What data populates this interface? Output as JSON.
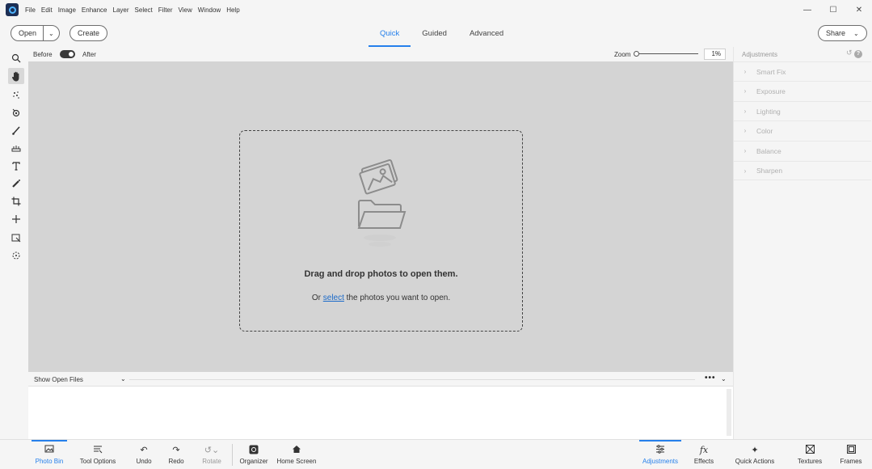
{
  "menubar": {
    "items": [
      "File",
      "Edit",
      "Image",
      "Enhance",
      "Layer",
      "Select",
      "Filter",
      "View",
      "Window",
      "Help"
    ]
  },
  "window_controls": {
    "minimize": "—",
    "maximize": "☐",
    "close": "✕"
  },
  "topbar": {
    "open_label": "Open",
    "create_label": "Create",
    "share_label": "Share",
    "modes": [
      "Quick",
      "Guided",
      "Advanced"
    ],
    "active_mode": "Quick"
  },
  "view_options": {
    "before_label": "Before",
    "after_label": "After",
    "zoom_label": "Zoom",
    "zoom_value": "1%"
  },
  "tools": [
    "zoom-tool",
    "hand-tool",
    "quick-selection-tool",
    "red-eye-tool",
    "whiten-teeth-tool",
    "straighten-tool",
    "type-tool",
    "spot-healing-tool",
    "crop-tool",
    "move-tool",
    "recompose-tool",
    "rotate-tool"
  ],
  "canvas": {
    "drop_title": "Drag and drop photos to open them.",
    "drop_prefix": "Or",
    "drop_link": "select",
    "drop_suffix": "the photos you want to open."
  },
  "photo_bin": {
    "selector_label": "Show Open Files",
    "more_label": "•••"
  },
  "adjustments": {
    "title": "Adjustments",
    "items": [
      "Smart Fix",
      "Exposure",
      "Lighting",
      "Color",
      "Balance",
      "Sharpen"
    ]
  },
  "bottombar": {
    "left": [
      {
        "label": "Photo Bin",
        "icon": "photo-bin-icon"
      },
      {
        "label": "Tool Options",
        "icon": "tool-options-icon"
      },
      {
        "label": "Undo",
        "icon": "undo-icon"
      },
      {
        "label": "Redo",
        "icon": "redo-icon"
      },
      {
        "label": "Rotate",
        "icon": "rotate-icon"
      },
      {
        "label": "Organizer",
        "icon": "organizer-icon"
      },
      {
        "label": "Home Screen",
        "icon": "home-icon"
      }
    ],
    "right": [
      {
        "label": "Adjustments",
        "icon": "adjustments-icon"
      },
      {
        "label": "Effects",
        "icon": "effects-icon"
      },
      {
        "label": "Quick Actions",
        "icon": "quick-actions-icon"
      },
      {
        "label": "Textures",
        "icon": "textures-icon"
      },
      {
        "label": "Frames",
        "icon": "frames-icon"
      }
    ]
  },
  "colors": {
    "accent": "#2680eb",
    "canvas": "#d4d4d4",
    "link": "#1b6ac9"
  }
}
